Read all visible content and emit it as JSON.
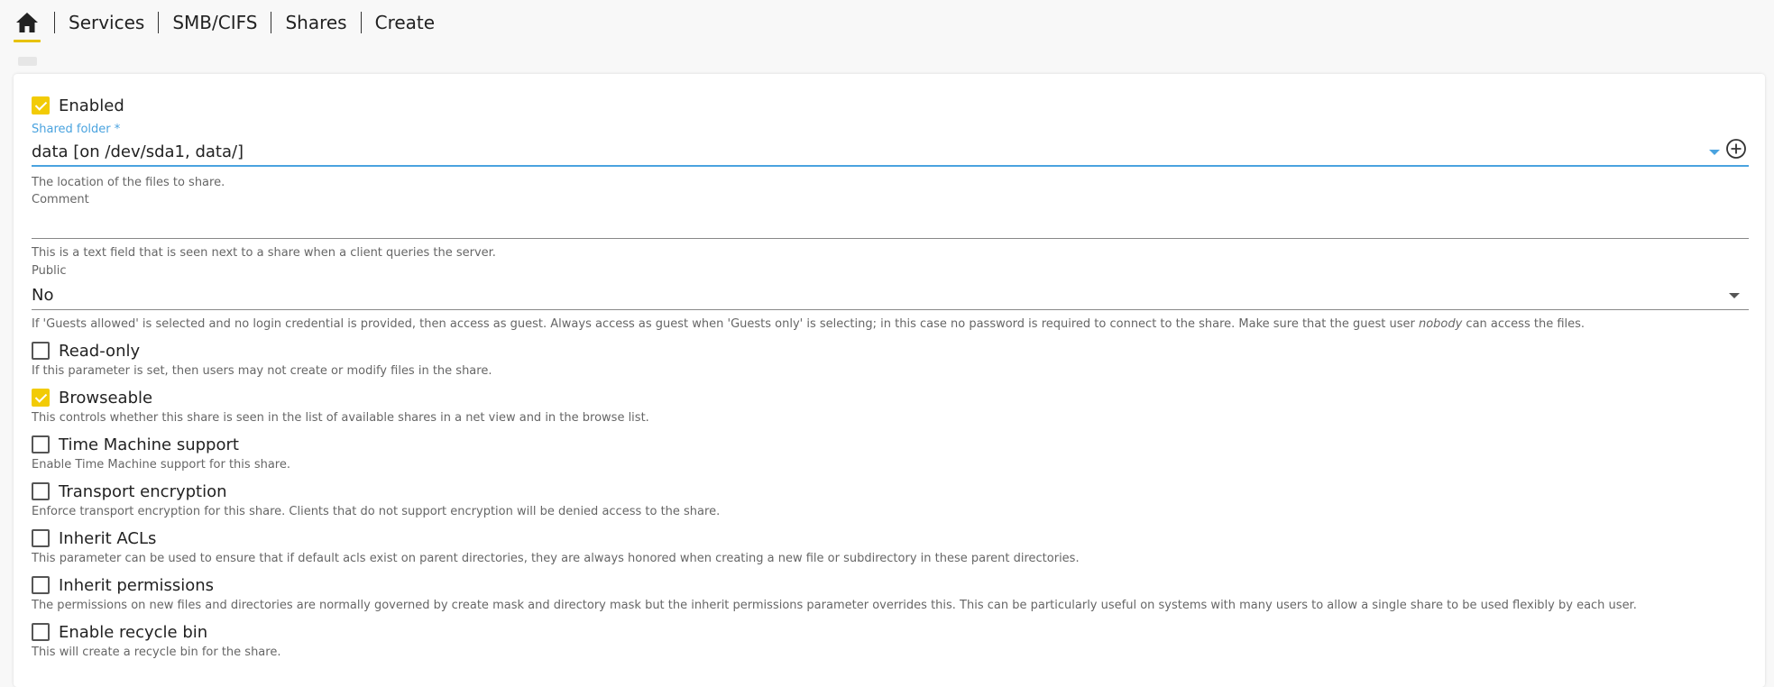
{
  "breadcrumb": {
    "items": [
      "Services",
      "SMB/CIFS",
      "Shares",
      "Create"
    ]
  },
  "badge": "",
  "form": {
    "enabled": {
      "label": "Enabled",
      "checked": true
    },
    "shared_folder": {
      "label": "Shared folder *",
      "value": "data [on /dev/sda1, data/]",
      "hint": "The location of the files to share."
    },
    "comment": {
      "label": "Comment",
      "value": "",
      "hint": "This is a text field that is seen next to a share when a client queries the server."
    },
    "public": {
      "label": "Public",
      "value": "No",
      "hint_before": "If 'Guests allowed' is selected and no login credential is provided, then access as guest. Always access as guest when 'Guests only' is selecting; in this case no password is required to connect to the share. Make sure that the guest user ",
      "hint_em": "nobody",
      "hint_after": " can access the files."
    },
    "read_only": {
      "label": "Read-only",
      "checked": false,
      "hint": "If this parameter is set, then users may not create or modify files in the share."
    },
    "browseable": {
      "label": "Browseable",
      "checked": true,
      "hint": "This controls whether this share is seen in the list of available shares in a net view and in the browse list."
    },
    "time_machine": {
      "label": "Time Machine support",
      "checked": false,
      "hint": "Enable Time Machine support for this share."
    },
    "transport_encryption": {
      "label": "Transport encryption",
      "checked": false,
      "hint": "Enforce transport encryption for this share. Clients that do not support encryption will be denied access to the share."
    },
    "inherit_acls": {
      "label": "Inherit ACLs",
      "checked": false,
      "hint": "This parameter can be used to ensure that if default acls exist on parent directories, they are always honored when creating a new file or subdirectory in these parent directories."
    },
    "inherit_permissions": {
      "label": "Inherit permissions",
      "checked": false,
      "hint": "The permissions on new files and directories are normally governed by create mask and directory mask but the inherit permissions parameter overrides this. This can be particularly useful on systems with many users to allow a single share to be used flexibly by each user."
    },
    "recycle_bin": {
      "label": "Enable recycle bin",
      "checked": false,
      "hint": "This will create a recycle bin for the share."
    }
  },
  "colors": {
    "accent": "#f2cb05",
    "focus": "#4aa3df",
    "home_underline": "#e7c200"
  },
  "icons": {
    "home": "home-icon",
    "add": "plus-circle-icon",
    "dropdown": "caret-down-icon",
    "check": "check-icon"
  }
}
